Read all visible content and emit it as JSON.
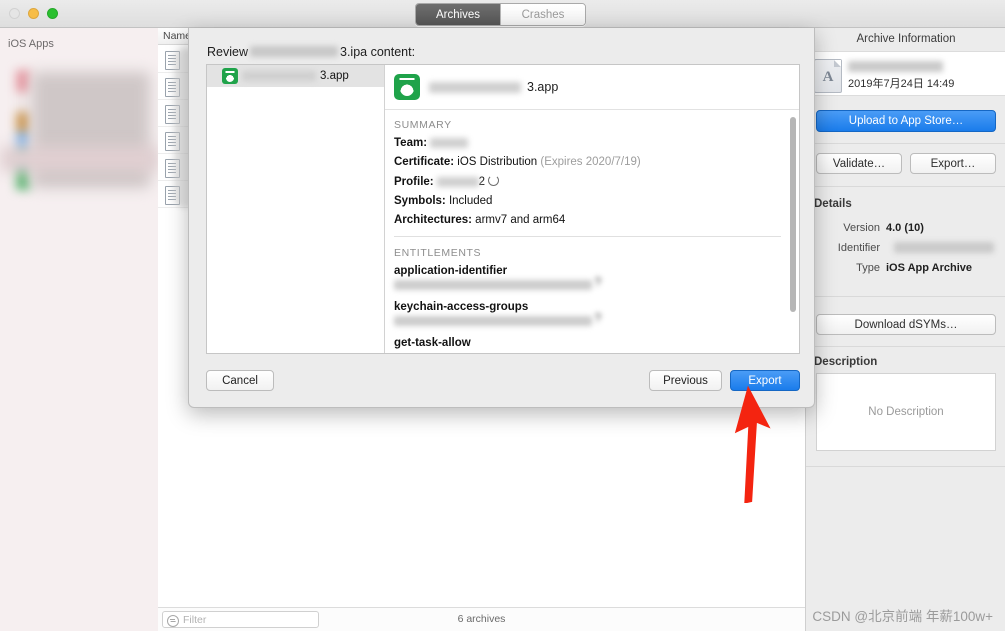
{
  "window": {
    "tabs": [
      {
        "label": "Archives",
        "active": true
      },
      {
        "label": "Crashes",
        "active": false
      }
    ]
  },
  "sidebar": {
    "title": "iOS Apps"
  },
  "archive_list": {
    "column_header": "Name",
    "row_count": 6
  },
  "sheet": {
    "title_prefix": "Review",
    "title_suffix": "3.ipa content:",
    "list": [
      {
        "label": "3.app",
        "icon": "flask-icon",
        "selected": true
      }
    ],
    "detail": {
      "app_name": "3.app",
      "summary_label": "SUMMARY",
      "summary": [
        {
          "key": "Team:",
          "value": "",
          "redacted": true
        },
        {
          "key": "Certificate:",
          "value": "iOS Distribution",
          "note": "(Expires 2020/7/19)"
        },
        {
          "key": "Profile:",
          "value": "2",
          "redacted": true,
          "reload": true
        },
        {
          "key": "Symbols:",
          "value": "Included"
        },
        {
          "key": "Architectures:",
          "value": "armv7 and arm64"
        }
      ],
      "entitlements_label": "ENTITLEMENTS",
      "entitlements": [
        {
          "key": "application-identifier",
          "value_redacted": true,
          "trailing": "?"
        },
        {
          "key": "keychain-access-groups",
          "value_redacted": true,
          "trailing": "?"
        },
        {
          "key": "get-task-allow",
          "value_redacted": false,
          "trailing": ""
        }
      ]
    },
    "buttons": {
      "cancel": "Cancel",
      "previous": "Previous",
      "export": "Export"
    }
  },
  "info_panel": {
    "title": "Archive Information",
    "date": "2019年7月24日 14:49",
    "upload_button": "Upload to App Store…",
    "validate_button": "Validate…",
    "export_button": "Export…",
    "details_label": "Details",
    "details": [
      {
        "key": "Version",
        "value": "4.0 (10)"
      },
      {
        "key": "Identifier",
        "value": "",
        "redacted": true
      },
      {
        "key": "Type",
        "value": "iOS App Archive"
      }
    ],
    "download_dsyms_button": "Download dSYMs…",
    "description_label": "Description",
    "description_empty": "No Description"
  },
  "bottom_bar": {
    "filter_placeholder": "Filter",
    "archive_count": "6 archives"
  },
  "watermark": "CSDN @北京前端 年薪100w+",
  "colors": {
    "accent_blue": "#1a7ceb",
    "app_icon_green": "#1fa34a",
    "arrow_red": "#f42410"
  }
}
